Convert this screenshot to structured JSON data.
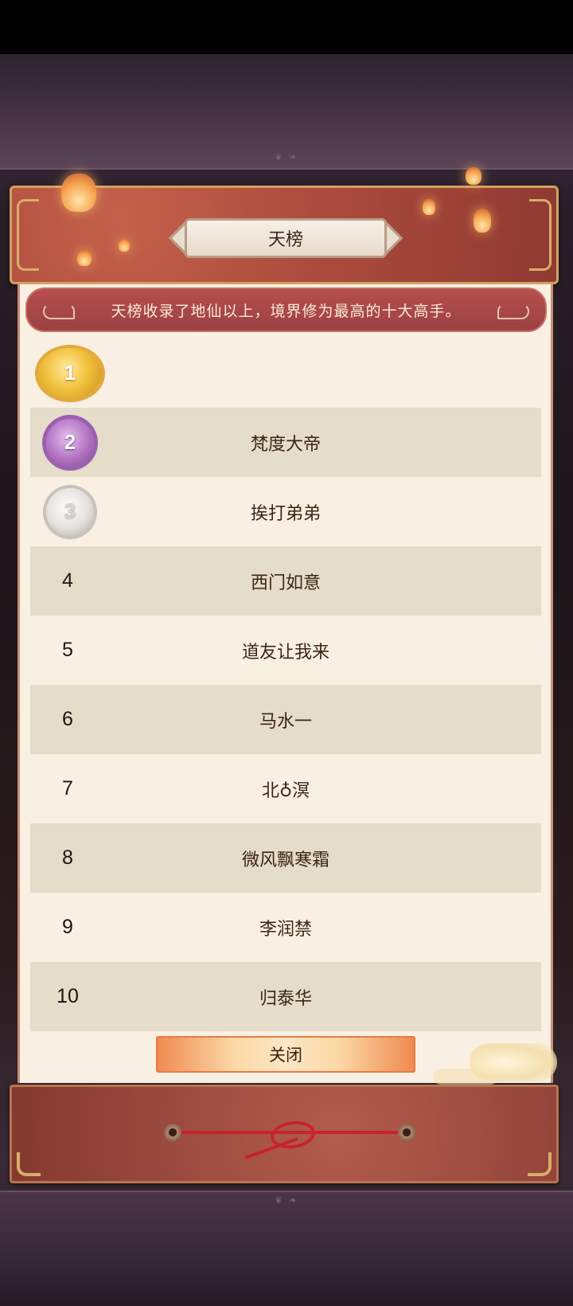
{
  "dialog": {
    "title": "天榜",
    "description": "天榜收录了地仙以上，境界修为最高的十大高手。",
    "close_label": "关闭"
  },
  "ranking": [
    {
      "rank": "1",
      "name": "",
      "medal": "gold-medal-icon"
    },
    {
      "rank": "2",
      "name": "梵度大帝",
      "medal": "purple-medal-icon"
    },
    {
      "rank": "3",
      "name": "挨打弟弟",
      "medal": "silver-medal-icon"
    },
    {
      "rank": "4",
      "name": "西门如意"
    },
    {
      "rank": "5",
      "name": "道友让我来"
    },
    {
      "rank": "6",
      "name": "马水一"
    },
    {
      "rank": "7",
      "name": "北♁溟"
    },
    {
      "rank": "8",
      "name": "微风飘寒霜"
    },
    {
      "rank": "9",
      "name": "李润禁"
    },
    {
      "rank": "10",
      "name": "归泰华"
    }
  ],
  "colors": {
    "paper": "#f9f0e3",
    "alt_row": "#e5dcca",
    "banner": "#a5464a",
    "scroll_red": "#ac4b3d",
    "button_orange": "#f08a52"
  }
}
